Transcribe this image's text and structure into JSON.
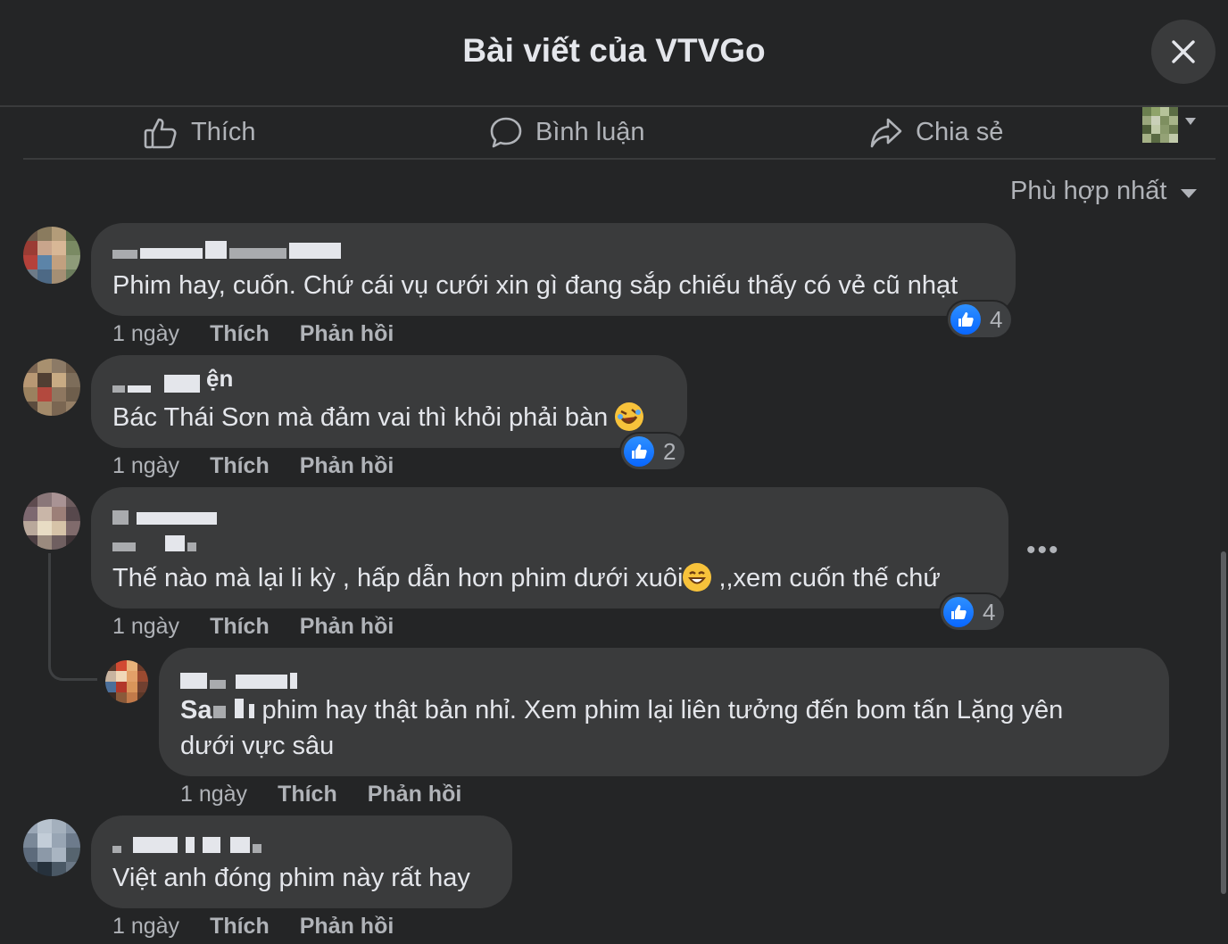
{
  "header": {
    "title": "Bài viết của VTVGo"
  },
  "actions": {
    "like": "Thích",
    "comment": "Bình luận",
    "share": "Chia sẻ"
  },
  "sort": {
    "label": "Phù hợp nhất"
  },
  "comments": [
    {
      "name": "",
      "text": "Phim hay, cuốn. Chứ cái vụ cưới xin gì đang sắp chiếu thấy có vẻ cũ nhạt",
      "time": "1 ngày",
      "like": "Thích",
      "reply": "Phản hồi",
      "reactions": "4"
    },
    {
      "name": "ện",
      "text": "Bác Thái Sơn mà đảm vai thì khỏi phải bàn",
      "time": "1 ngày",
      "like": "Thích",
      "reply": "Phản hồi",
      "reactions": "2"
    },
    {
      "name": "",
      "text": "Thế nào mà lại li kỳ ,  hấp dẫn hơn phim dưới xuôi",
      "text_after": " ,,xem cuốn thế chứ",
      "time": "1 ngày",
      "like": "Thích",
      "reply": "Phản hồi",
      "reactions": "4"
    },
    {
      "name": "",
      "mention": "Sa",
      "text": " phim hay thật bản nhỉ. Xem phim lại liên tưởng đến bom tấn Lặng yên",
      "text_line2": "dưới vực sâu",
      "time": "1 ngày",
      "like": "Thích",
      "reply": "Phản hồi"
    },
    {
      "name": "",
      "text": "Việt anh đóng phim này rất hay",
      "time": "1 ngày",
      "like": "Thích",
      "reply": "Phản hồi"
    }
  ],
  "icons": {
    "close": "close-icon",
    "like": "like-icon",
    "comment": "comment-icon",
    "share": "share-icon",
    "more": "more-icon"
  },
  "colors": {
    "background": "#242526",
    "bubble": "#3a3b3c",
    "like_blue": "#0866ff"
  }
}
